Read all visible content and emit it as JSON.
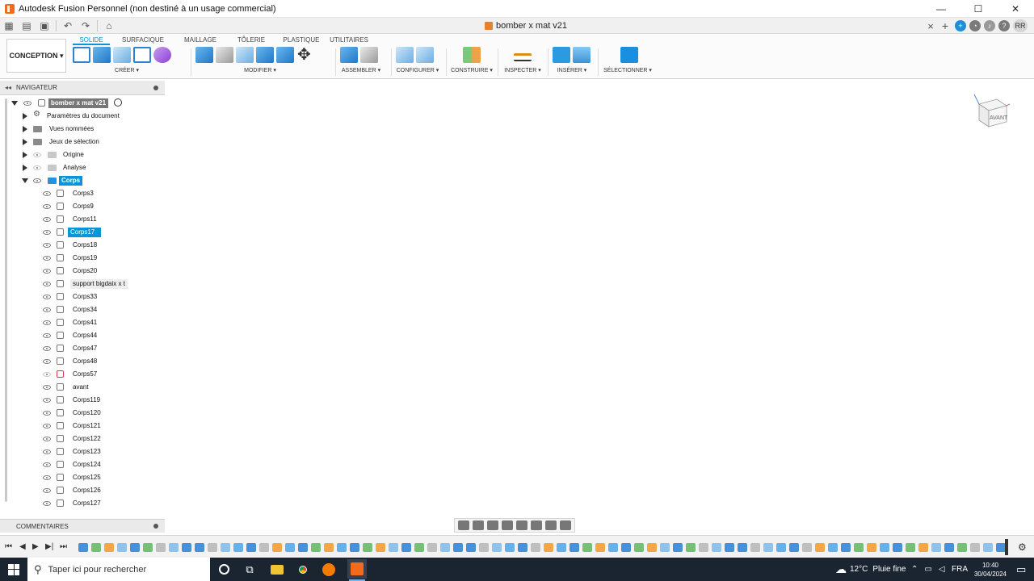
{
  "window": {
    "title": "Autodesk Fusion Personnel (non destiné à un usage commercial)",
    "minimize": "—",
    "maximize": "☐",
    "close": "✕"
  },
  "quickaccess": {
    "doc_tab": "bomber x mat v21",
    "doc_close": "×",
    "add_tab": "+",
    "avatar": "RR"
  },
  "ribbon": {
    "workspace": "CONCEPTION ▾",
    "tabs": [
      "SOLIDE",
      "SURFACIQUE",
      "MAILLAGE",
      "TÔLERIE",
      "PLASTIQUE",
      "UTILITAIRES"
    ],
    "groups": {
      "create": "CRÉER ▾",
      "modify": "MODIFIER ▾",
      "assemble": "ASSEMBLER ▾",
      "configure": "CONFIGURER ▾",
      "construct": "CONSTRUIRE ▾",
      "inspect": "INSPECTER ▾",
      "insert": "INSÉRER ▾",
      "select": "SÉLECTIONNER ▾"
    }
  },
  "navigator": {
    "header": "NAVIGATEUR",
    "root": "bomber x mat v21",
    "folders": [
      {
        "label": "Paramètres du document"
      },
      {
        "label": "Vues nommées"
      },
      {
        "label": "Jeux de sélection"
      },
      {
        "label": "Origine"
      },
      {
        "label": "Analyse"
      },
      {
        "label": "Corps"
      }
    ],
    "bodies": [
      "Corps3",
      "Corps9",
      "Corps11",
      "Corps17",
      "Corps18",
      "Corps19",
      "Corps20",
      "support bigdaix x t",
      "Corps33",
      "Corps34",
      "Corps41",
      "Corps44",
      "Corps47",
      "Corps48",
      "Corps57",
      "avant",
      "Corps119",
      "Corps120",
      "Corps121",
      "Corps122",
      "Corps123",
      "Corps124",
      "Corps125",
      "Corps126",
      "Corps127"
    ],
    "selected_body": "Corps17"
  },
  "comments": {
    "header": "COMMENTAIRES"
  },
  "viewcube": {
    "label": "AVANT"
  },
  "taskbar": {
    "search_placeholder": "Taper ici pour rechercher",
    "weather_temp": "12°C",
    "weather_text": "Pluie fine",
    "language": "FRA",
    "time": "10:40",
    "date": "30/04/2024"
  },
  "colors": {
    "accent": "#0696d7",
    "model_gray": "#8a8782",
    "taskbar": "#1b2431"
  }
}
